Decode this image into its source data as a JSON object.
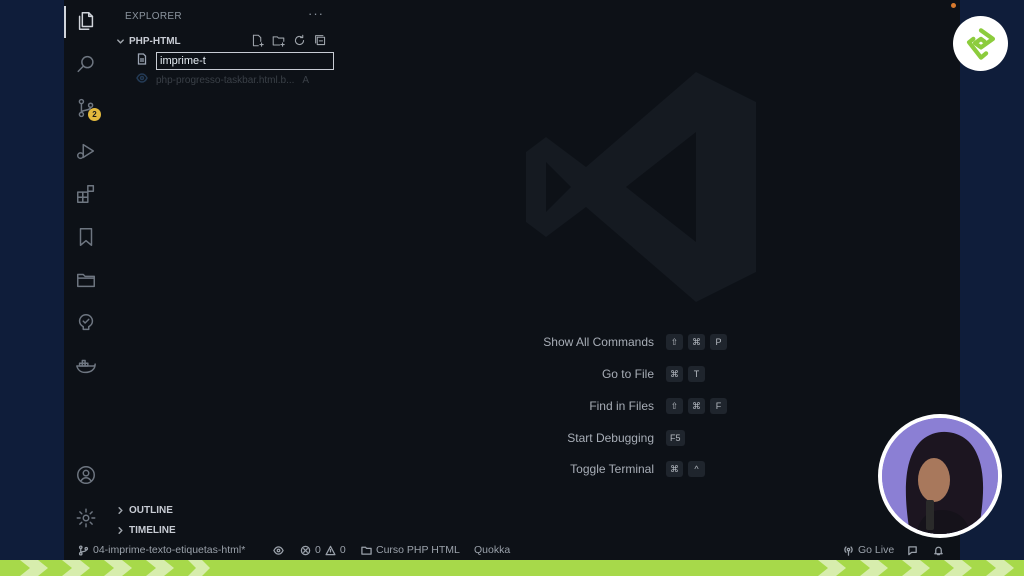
{
  "colors": {
    "frame": "#0f1d3a",
    "editor_bg": "#0d1117",
    "accent_green": "#a7d94a",
    "badge": "#e2b93d",
    "webcam_bg": "#8b7fd4"
  },
  "activity_bar": {
    "items": [
      {
        "name": "explorer",
        "icon": "files-icon",
        "active": true
      },
      {
        "name": "search",
        "icon": "search-icon"
      },
      {
        "name": "source-control",
        "icon": "source-control-icon",
        "badge": "2"
      },
      {
        "name": "run-debug",
        "icon": "run-debug-icon"
      },
      {
        "name": "extensions",
        "icon": "extensions-icon"
      },
      {
        "name": "bookmarks",
        "icon": "bookmark-icon"
      },
      {
        "name": "project-manager",
        "icon": "folder-icon"
      },
      {
        "name": "testing",
        "icon": "testing-icon"
      },
      {
        "name": "docker",
        "icon": "docker-icon"
      }
    ],
    "bottom": [
      {
        "name": "accounts",
        "icon": "account-icon"
      },
      {
        "name": "manage",
        "icon": "gear-icon"
      }
    ]
  },
  "sidebar": {
    "title": "EXPLORER",
    "more": "···",
    "folder": "PHP-HTML",
    "rename_value": "imprime-t",
    "ghost_file": "php-progresso-taskbar.html.b...",
    "ghost_mod": "A",
    "outline": "OUTLINE",
    "timeline": "TIMELINE"
  },
  "shortcuts": [
    {
      "label": "Show All Commands",
      "keys": [
        "⇧",
        "⌘",
        "P"
      ]
    },
    {
      "label": "Go to File",
      "keys": [
        "⌘",
        "T"
      ]
    },
    {
      "label": "Find in Files",
      "keys": [
        "⇧",
        "⌘",
        "F"
      ]
    },
    {
      "label": "Start Debugging",
      "keys": [
        "F5"
      ]
    },
    {
      "label": "Toggle Terminal",
      "keys": [
        "⌘",
        "^"
      ]
    }
  ],
  "statusbar": {
    "branch": "04-imprime-texto-etiquetas-html*",
    "errors": "0",
    "warnings": "0",
    "workspace": "Curso PHP HTML",
    "quokka": "Quokka",
    "go_live": "Go Live"
  }
}
